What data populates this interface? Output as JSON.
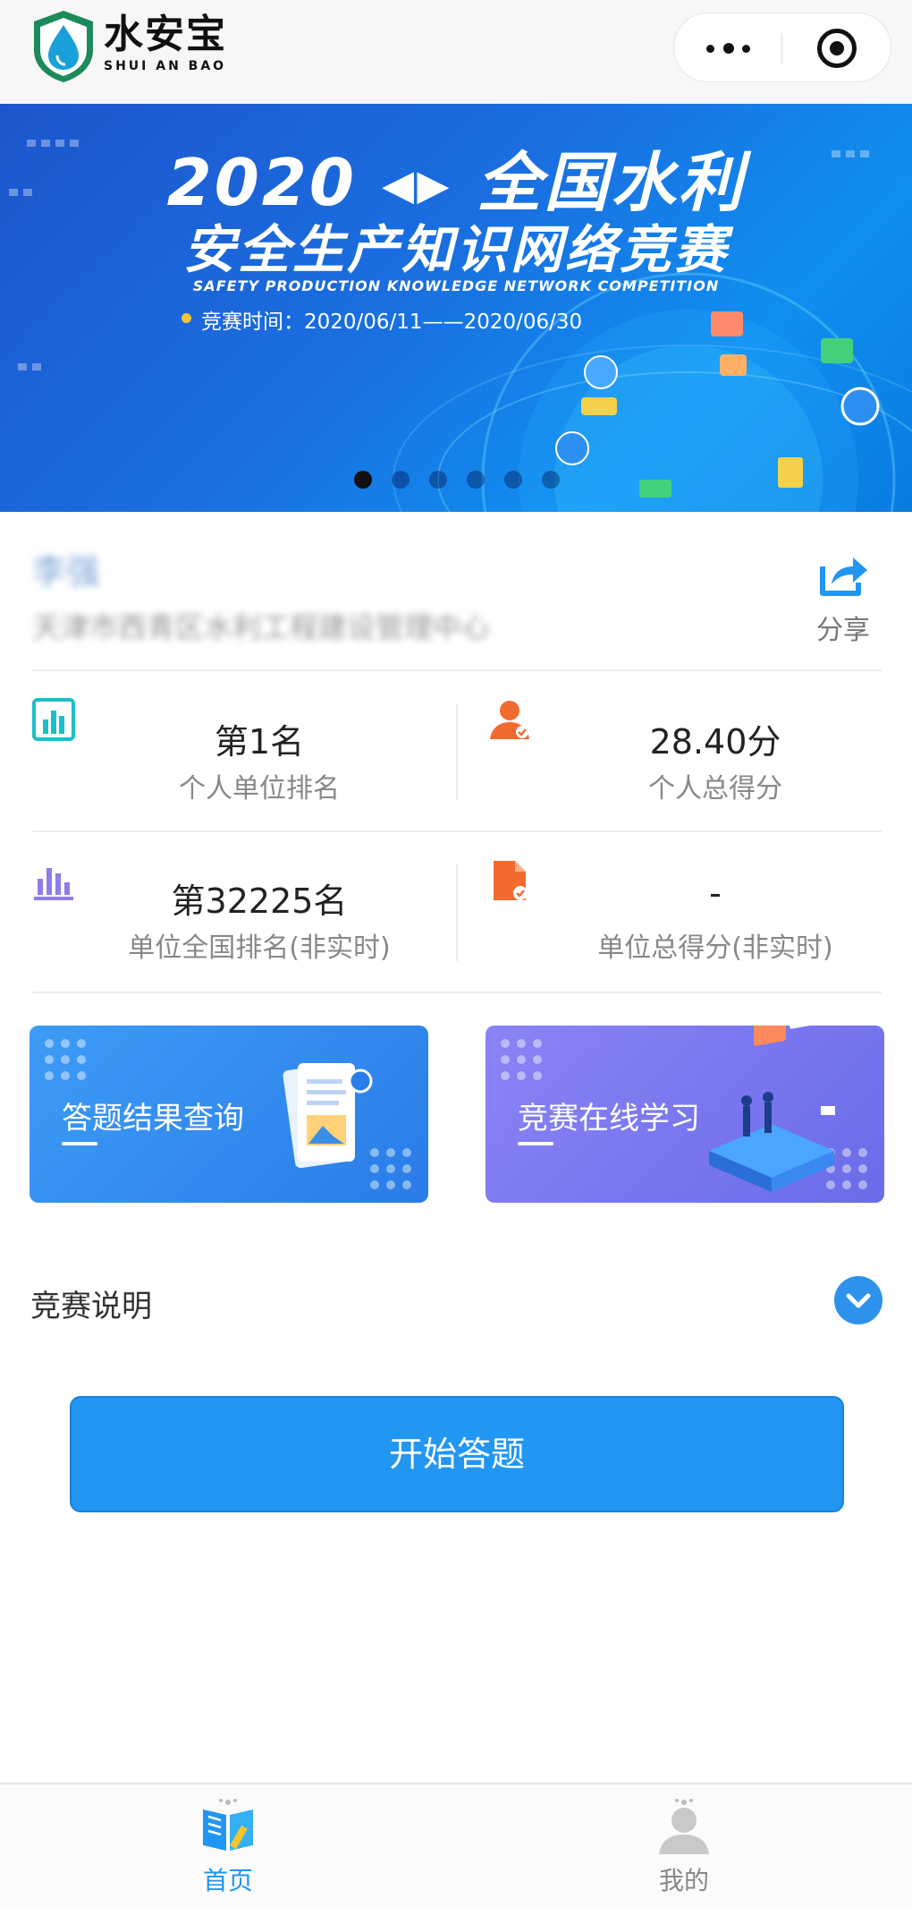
{
  "header": {
    "logo_cn": "水安宝",
    "logo_en": "SHUI AN BAO"
  },
  "banner": {
    "title_line1": "2020 ◂▸ 全国水利",
    "title_line2": "安全生产知识网络竞赛",
    "subtitle_en": "SAFETY PRODUCTION KNOWLEDGE NETWORK COMPETITION",
    "time_text": "竞赛时间：2020/06/11——2020/06/30",
    "slide_count": 6,
    "active_slide": 1
  },
  "user": {
    "name": "李强",
    "organization": "天津市西青区水利工程建设管理中心",
    "share_label": "分享"
  },
  "stats": {
    "personal_rank_value": "第1名",
    "personal_rank_label": "个人单位排名",
    "personal_score_value": "28.40分",
    "personal_score_label": "个人总得分",
    "unit_rank_value": "第32225名",
    "unit_rank_label": "单位全国排名(非实时)",
    "unit_score_value": "-",
    "unit_score_label": "单位总得分(非实时)"
  },
  "cards": {
    "query_title": "答题结果查询",
    "learn_title": "竞赛在线学习"
  },
  "description": {
    "label": "竞赛说明"
  },
  "start_button": {
    "label": "开始答题"
  },
  "tabbar": {
    "home_label": "首页",
    "mine_label": "我的",
    "active_tab": "首页"
  },
  "colors": {
    "primary_blue": "#2196f3",
    "teal_icon": "#1bc0c9",
    "orange_icon": "#f26a2e",
    "purple_icon": "#8b7ee8",
    "query_card": "#3d9cf5",
    "learn_card": "#7b78f0"
  }
}
